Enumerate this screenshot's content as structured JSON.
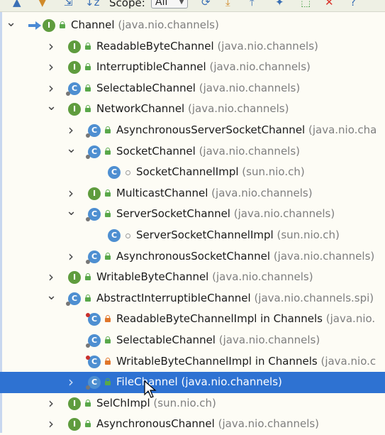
{
  "toolbar": {
    "scope_label": "Scope:",
    "scope_value": "All"
  },
  "rows": [
    {
      "name": "Channel",
      "pkg": "(java.nio.channels)",
      "kind": "i",
      "vis": "pub",
      "depth": 0,
      "arrow": "expanded",
      "root": true
    },
    {
      "name": "ReadableByteChannel",
      "pkg": "(java.nio.channels)",
      "kind": "i",
      "vis": "pub",
      "depth": 1,
      "arrow": "collapsed"
    },
    {
      "name": "InterruptibleChannel",
      "pkg": "(java.nio.channels)",
      "kind": "i",
      "vis": "pub",
      "depth": 1,
      "arrow": "collapsed"
    },
    {
      "name": "SelectableChannel",
      "pkg": "(java.nio.channels)",
      "kind": "c",
      "vis": "pub",
      "depth": 1,
      "arrow": "collapsed",
      "abstract": true
    },
    {
      "name": "NetworkChannel",
      "pkg": "(java.nio.channels)",
      "kind": "i",
      "vis": "pub",
      "depth": 1,
      "arrow": "expanded"
    },
    {
      "name": "AsynchronousServerSocketChannel",
      "pkg": "(java.nio.cha",
      "kind": "c",
      "vis": "pub",
      "depth": 2,
      "arrow": "collapsed",
      "abstract": true
    },
    {
      "name": "SocketChannel",
      "pkg": "(java.nio.channels)",
      "kind": "c",
      "vis": "pub",
      "depth": 2,
      "arrow": "expanded",
      "abstract": true
    },
    {
      "name": "SocketChannelImpl",
      "pkg": "(sun.nio.ch)",
      "kind": "c",
      "vis": "pkg",
      "depth": 3,
      "arrow": "none"
    },
    {
      "name": "MulticastChannel",
      "pkg": "(java.nio.channels)",
      "kind": "i",
      "vis": "pub",
      "depth": 2,
      "arrow": "collapsed"
    },
    {
      "name": "ServerSocketChannel",
      "pkg": "(java.nio.channels)",
      "kind": "c",
      "vis": "pub",
      "depth": 2,
      "arrow": "expanded",
      "abstract": true
    },
    {
      "name": "ServerSocketChannelImpl",
      "pkg": "(sun.nio.ch)",
      "kind": "c",
      "vis": "pkg",
      "depth": 3,
      "arrow": "none"
    },
    {
      "name": "AsynchronousSocketChannel",
      "pkg": "(java.nio.channels)",
      "kind": "c",
      "vis": "pub",
      "depth": 2,
      "arrow": "collapsed",
      "abstract": true
    },
    {
      "name": "WritableByteChannel",
      "pkg": "(java.nio.channels)",
      "kind": "i",
      "vis": "pub",
      "depth": 1,
      "arrow": "collapsed"
    },
    {
      "name": "AbstractInterruptibleChannel",
      "pkg": "(java.nio.channels.spi)",
      "kind": "c",
      "vis": "pub",
      "depth": 1,
      "arrow": "expanded",
      "abstract": true
    },
    {
      "name": "ReadableByteChannelImpl in Channels",
      "pkg": "(java.nio.",
      "kind": "c",
      "vis": "priv",
      "depth": 2,
      "arrow": "none",
      "pinned": true
    },
    {
      "name": "SelectableChannel",
      "pkg": "(java.nio.channels)",
      "kind": "c",
      "vis": "pub",
      "depth": 2,
      "arrow": "none",
      "abstract": true
    },
    {
      "name": "WritableByteChannelImpl in Channels",
      "pkg": "(java.nio.c",
      "kind": "c",
      "vis": "priv",
      "depth": 2,
      "arrow": "none",
      "pinned": true
    },
    {
      "name": "FileChannel",
      "pkg": "(java.nio.channels)",
      "kind": "c",
      "vis": "pub",
      "depth": 2,
      "arrow": "collapsed",
      "abstract": true,
      "selected": true
    },
    {
      "name": "SelChImpl",
      "pkg": "(sun.nio.ch)",
      "kind": "i",
      "vis": "pub",
      "depth": 1,
      "arrow": "collapsed"
    },
    {
      "name": "AsynchronousChannel",
      "pkg": "(java.nio.channels)",
      "kind": "i",
      "vis": "pub",
      "depth": 1,
      "arrow": "collapsed"
    }
  ]
}
